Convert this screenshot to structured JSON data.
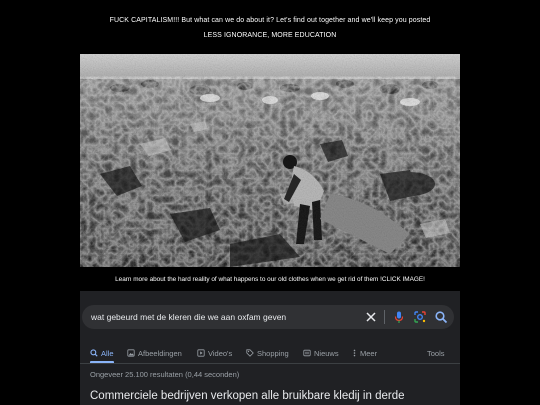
{
  "header": {
    "line1": "FUCK CAPITALISM!!! But what can we do about it? Let's find out together and we'll keep you posted",
    "line2": "LESS IGNORANCE, MORE EDUCATION"
  },
  "photo": {
    "subject": "black-and-white-landfill-photo"
  },
  "caption": "Learn more about the hard reality of what happens to our old clothes when we get rid of them !CLICK IMAGE!",
  "google": {
    "query": "wat gebeurd met de kleren die we aan oxfam geven",
    "icons": [
      "close-icon",
      "microphone-icon",
      "lens-icon",
      "search-icon"
    ],
    "tabs": [
      {
        "label": "Alle",
        "icon": "search-icon",
        "active": true
      },
      {
        "label": "Afbeeldingen",
        "icon": "image-icon",
        "active": false
      },
      {
        "label": "Video's",
        "icon": "play-icon",
        "active": false
      },
      {
        "label": "Shopping",
        "icon": "tag-icon",
        "active": false
      },
      {
        "label": "Nieuws",
        "icon": "news-icon",
        "active": false
      },
      {
        "label": "Meer",
        "icon": "more-icon",
        "active": false
      }
    ],
    "tools_label": "Tools",
    "result_stats": "Ongeveer 25.100 resultaten (0,44 seconden)",
    "first_result_title": "Commerciele bedrijven verkopen alle bruikbare kledij in derde",
    "colors": {
      "background": "#202124",
      "search_bg": "#303134",
      "active_tab": "#8ab4f8",
      "muted_text": "#9aa0a6",
      "text": "#e8eaed"
    }
  }
}
